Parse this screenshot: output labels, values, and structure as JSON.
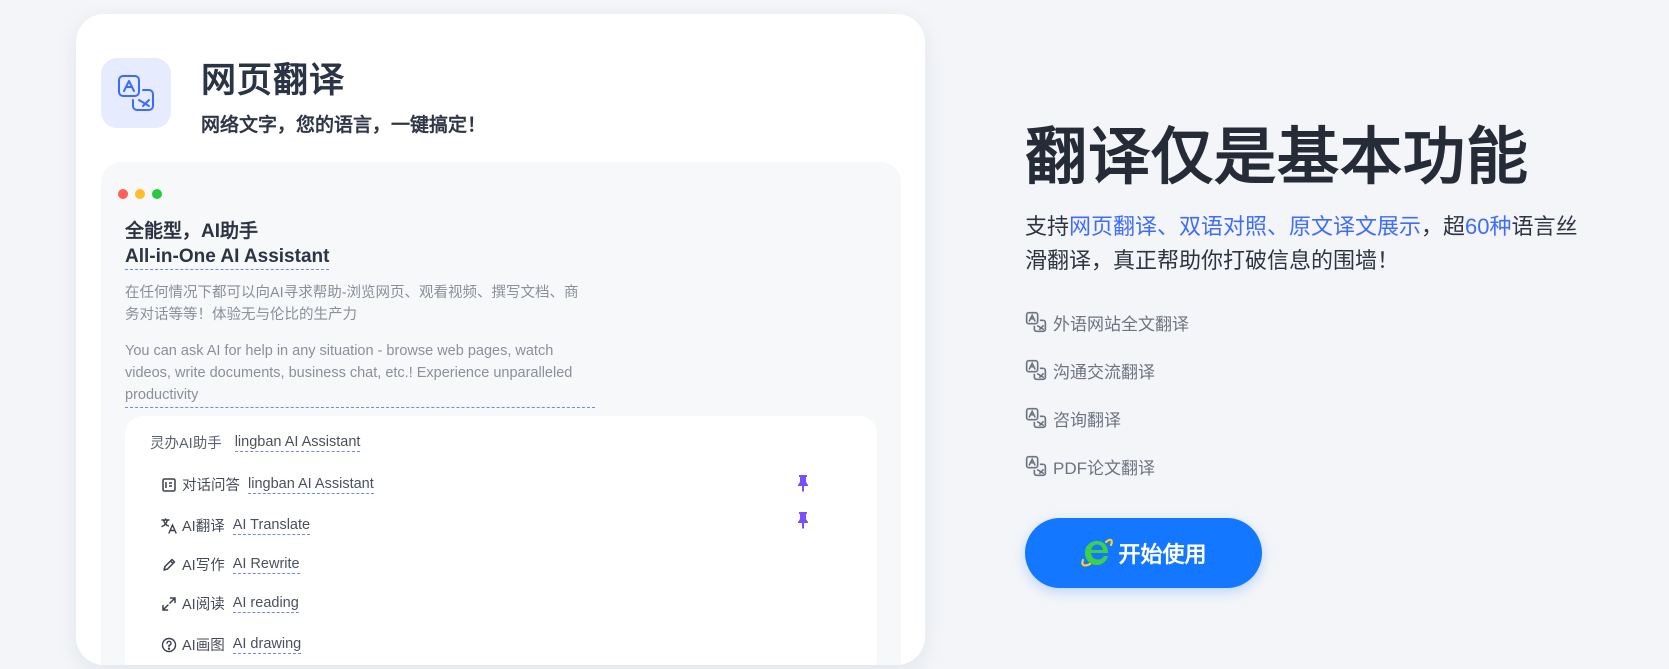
{
  "card": {
    "title": "网页翻译",
    "subtitle": "网络文字，您的语言，一键搞定！",
    "icon": "translate-icon"
  },
  "preview": {
    "heading_cn": "全能型，AI助手",
    "heading_en": "All-in-One AI Assistant",
    "desc_cn": "在任何情况下都可以向AI寻求帮助-浏览网页、观看视频、撰写文档、商务对话等等！体验无与伦比的生产力",
    "desc_en": "You can ask AI for help in any situation - browse web pages, watch videos, write documents, business chat, etc.! Experience unparalleled productivity",
    "menu_head_cn": "灵办AI助手",
    "menu_head_en": "lingban AI Assistant",
    "menu": [
      {
        "icon": "chat-icon",
        "cn": "对话问答",
        "en": "lingban AI Assistant",
        "pinned": true
      },
      {
        "icon": "translate-icon",
        "cn": "AI翻译",
        "en": "AI Translate",
        "pinned": true
      },
      {
        "icon": "pencil-icon",
        "cn": "AI写作",
        "en": "AI Rewrite",
        "pinned": false
      },
      {
        "icon": "expand-icon",
        "cn": "AI阅读",
        "en": "AI reading",
        "pinned": false
      },
      {
        "icon": "help-circle-icon",
        "cn": "AI画图",
        "en": "AI drawing",
        "pinned": false
      }
    ]
  },
  "hero": {
    "title": "翻译仅是基本功能",
    "desc_part1": "支持",
    "desc_hl1": "网页翻译、双语对照、原文译文展示",
    "desc_part2": "，超",
    "desc_hl2": "60种",
    "desc_part3": "语言丝滑翻译，真正帮助你打破信息的围墙！",
    "features": [
      "外语网站全文翻译",
      "沟通交流翻译",
      "咨询翻译",
      "PDF论文翻译"
    ],
    "cta_label": "开始使用"
  },
  "colors": {
    "accent": "#1477ff",
    "highlight": "#3f6bff",
    "pin": "#7b4dff"
  }
}
